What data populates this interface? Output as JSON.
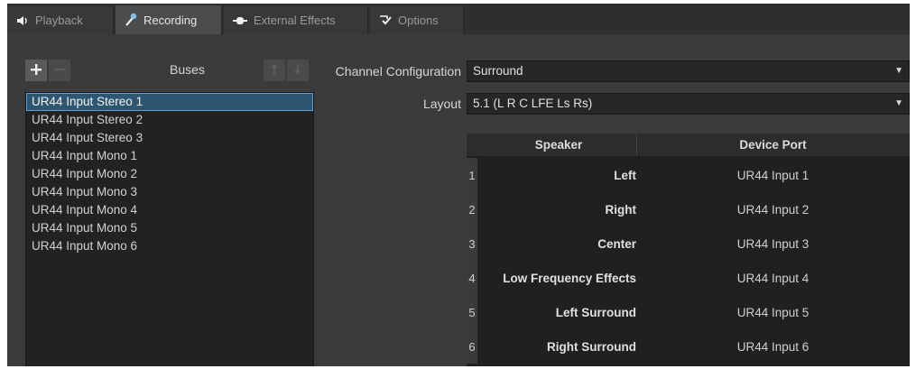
{
  "tabs": [
    {
      "label": "Playback",
      "icon": "speaker-icon",
      "active": false
    },
    {
      "label": "Recording",
      "icon": "microphone-icon",
      "active": true
    },
    {
      "label": "External Effects",
      "icon": "plug-icon",
      "active": false
    },
    {
      "label": "Options",
      "icon": "checkmark-icon",
      "active": false
    }
  ],
  "buses": {
    "label": "Buses",
    "items": [
      "UR44 Input Stereo 1",
      "UR44 Input Stereo 2",
      "UR44 Input Stereo 3",
      "UR44 Input Mono 1",
      "UR44 Input Mono 2",
      "UR44 Input Mono 3",
      "UR44 Input Mono 4",
      "UR44 Input Mono 5",
      "UR44 Input Mono 6"
    ],
    "selected_index": 0
  },
  "channel_config": {
    "label": "Channel Configuration",
    "value": "Surround"
  },
  "layout": {
    "label": "Layout",
    "value": "5.1 (L R C LFE Ls Rs)"
  },
  "speaker_table": {
    "columns": [
      "Speaker",
      "Device Port"
    ],
    "rows": [
      {
        "num": "1",
        "speaker": "Left",
        "port": "UR44 Input 1"
      },
      {
        "num": "2",
        "speaker": "Right",
        "port": "UR44 Input 2"
      },
      {
        "num": "3",
        "speaker": "Center",
        "port": "UR44 Input 3"
      },
      {
        "num": "4",
        "speaker": "Low Frequency Effects",
        "port": "UR44 Input 4"
      },
      {
        "num": "5",
        "speaker": "Left Surround",
        "port": "UR44 Input 5"
      },
      {
        "num": "6",
        "speaker": "Right Surround",
        "port": "UR44 Input 6"
      }
    ]
  },
  "colors": {
    "background": "#3b3b3b",
    "selection": "#2f5670",
    "selection_border": "#5aa0d6"
  }
}
